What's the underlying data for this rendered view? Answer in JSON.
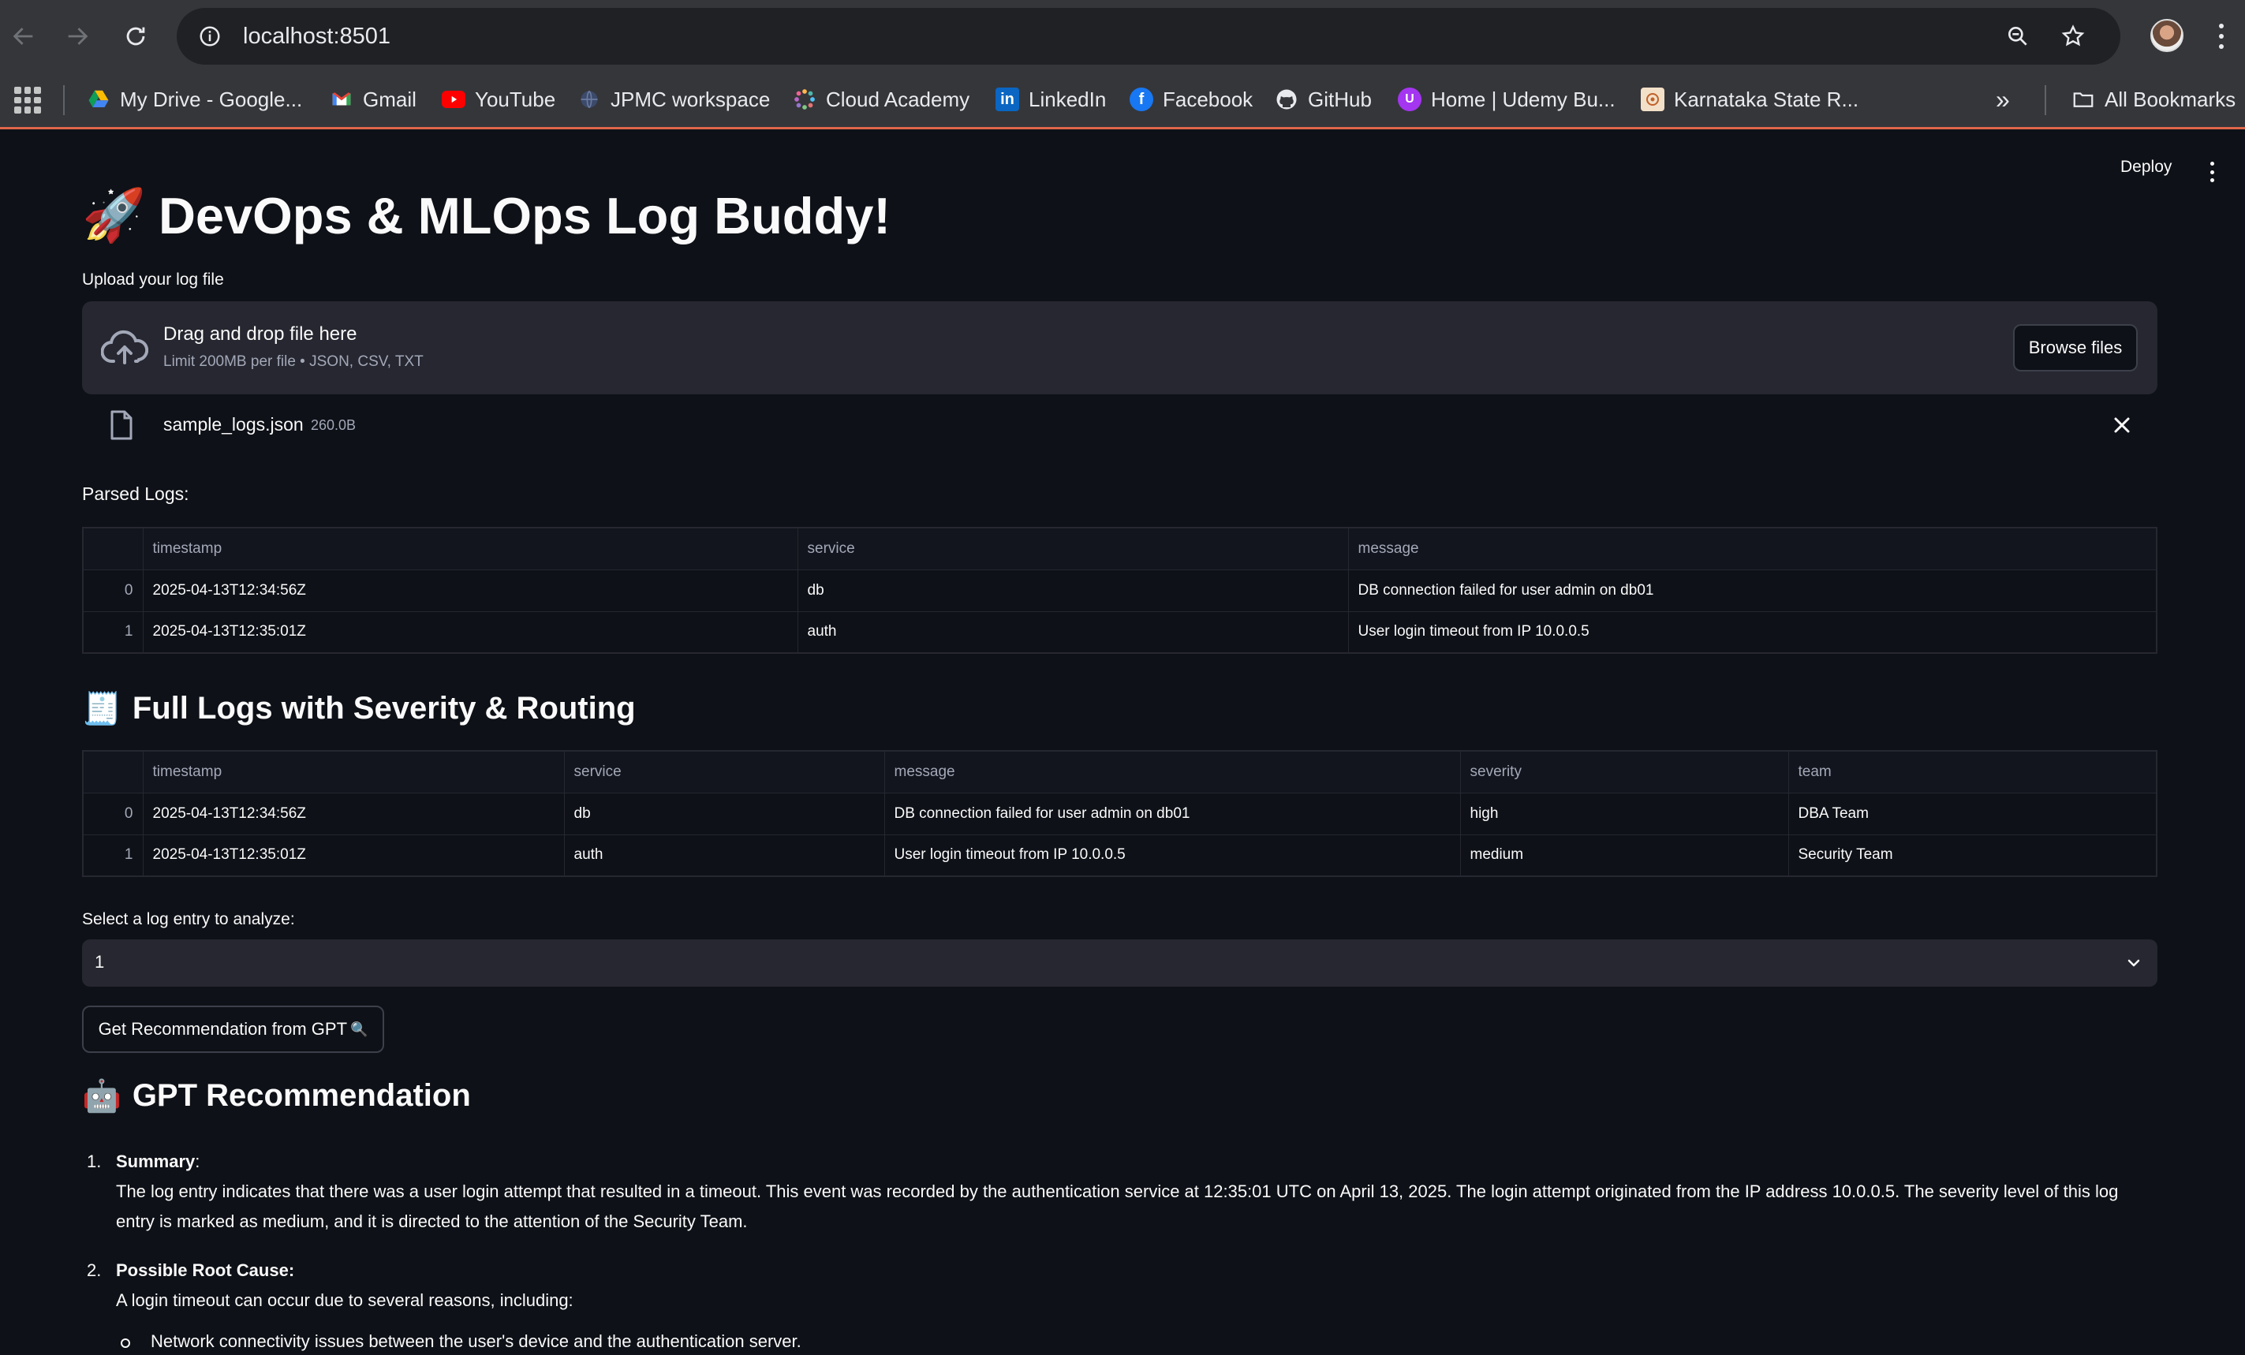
{
  "browser": {
    "url": "localhost:8501",
    "bookmarks": [
      {
        "label": "My Drive - Google...",
        "icon": "google-drive-icon"
      },
      {
        "label": "Gmail",
        "icon": "gmail-icon"
      },
      {
        "label": "YouTube",
        "icon": "youtube-icon"
      },
      {
        "label": "JPMC workspace",
        "icon": "globe-icon"
      },
      {
        "label": "Cloud Academy",
        "icon": "cloud-academy-icon"
      },
      {
        "label": "LinkedIn",
        "icon": "linkedin-icon"
      },
      {
        "label": "Facebook",
        "icon": "facebook-icon"
      },
      {
        "label": "GitHub",
        "icon": "github-icon"
      },
      {
        "label": "Home | Udemy Bu...",
        "icon": "udemy-icon"
      },
      {
        "label": "Karnataka State R...",
        "icon": "karnataka-icon"
      }
    ],
    "all_bookmarks": "All Bookmarks",
    "more_bookmarks": "»"
  },
  "app": {
    "deploy_label": "Deploy",
    "title": "DevOps & MLOps Log Buddy!",
    "title_emoji": "🚀",
    "upload": {
      "label": "Upload your log file",
      "drop_title": "Drag and drop file here",
      "drop_limit": "Limit 200MB per file • JSON, CSV, TXT",
      "browse_label": "Browse files",
      "file_name": "sample_logs.json",
      "file_size": "260.0B"
    },
    "parsed": {
      "label": "Parsed Logs:",
      "columns": [
        "timestamp",
        "service",
        "message"
      ],
      "rows": [
        {
          "idx": "0",
          "timestamp": "2025-04-13T12:34:56Z",
          "service": "db",
          "message": "DB connection failed for user admin on db01"
        },
        {
          "idx": "1",
          "timestamp": "2025-04-13T12:35:01Z",
          "service": "auth",
          "message": "User login timeout from IP 10.0.0.5"
        }
      ]
    },
    "full": {
      "heading": "Full Logs with Severity & Routing",
      "heading_emoji": "🧾",
      "columns": [
        "timestamp",
        "service",
        "message",
        "severity",
        "team"
      ],
      "rows": [
        {
          "idx": "0",
          "timestamp": "2025-04-13T12:34:56Z",
          "service": "db",
          "message": "DB connection failed for user admin on db01",
          "severity": "high",
          "team": "DBA Team"
        },
        {
          "idx": "1",
          "timestamp": "2025-04-13T12:35:01Z",
          "service": "auth",
          "message": "User login timeout from IP 10.0.0.5",
          "severity": "medium",
          "team": "Security Team"
        }
      ]
    },
    "select": {
      "label": "Select a log entry to analyze:",
      "value": "1"
    },
    "gpt_button": "Get Recommendation from GPT",
    "gpt_button_emoji": "🔍",
    "recommendation": {
      "heading": "GPT Recommendation",
      "heading_emoji": "🤖",
      "items": [
        {
          "num": "1.",
          "title": "Summary",
          "colon": ":",
          "text": "The log entry indicates that there was a user login attempt that resulted in a timeout. This event was recorded by the authentication service at 12:35:01 UTC on April 13, 2025. The login attempt originated from the IP address 10.0.0.5. The severity level of this log entry is marked as medium, and it is directed to the attention of the Security Team."
        },
        {
          "num": "2.",
          "title": "Possible Root Cause:",
          "colon": "",
          "text": "A login timeout can occur due to several reasons, including:",
          "bullets": [
            "Network connectivity issues between the user's device and the authentication server."
          ]
        }
      ]
    }
  }
}
